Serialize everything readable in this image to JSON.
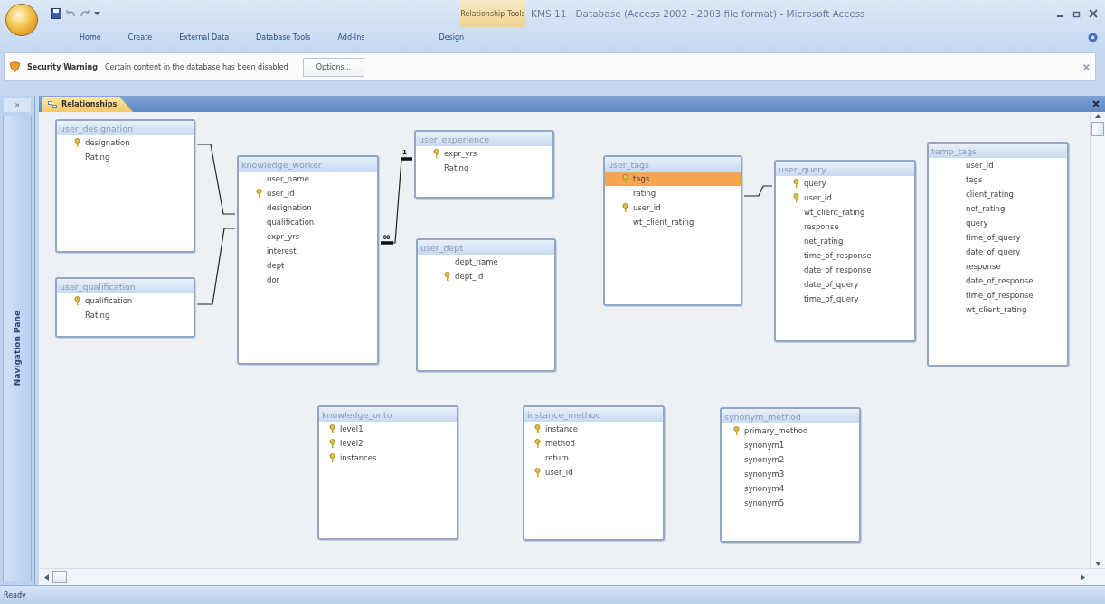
{
  "window": {
    "title": "KMS 11 : Database (Access 2002 - 2003 file format) - Microsoft Access"
  },
  "ribbon": {
    "tabs": [
      {
        "label": "Home",
        "selected": false
      },
      {
        "label": "Create",
        "selected": false
      },
      {
        "label": "External Data",
        "selected": false
      },
      {
        "label": "Database Tools",
        "selected": false
      },
      {
        "label": "Add-Ins",
        "selected": false
      }
    ],
    "contextual_group": {
      "label": "Relationship Tools",
      "tabs": [
        {
          "label": "Design",
          "selected": false
        }
      ]
    }
  },
  "security_bar": {
    "label": "Security Warning",
    "message": "Certain content in the database has been disabled",
    "button": "Options..."
  },
  "navigation_pane": {
    "toggle": "»",
    "label": "Navigation Pane"
  },
  "document_tabs": [
    {
      "label": "Relationships",
      "selected": true
    }
  ],
  "tables": [
    {
      "name": "user_designation",
      "fields": [
        {
          "name": "designation",
          "key": true,
          "selected": false
        },
        {
          "name": "Rating",
          "key": false,
          "selected": false
        }
      ]
    },
    {
      "name": "user_qualification",
      "fields": [
        {
          "name": "qualification",
          "key": true,
          "selected": false
        },
        {
          "name": "Rating",
          "key": false,
          "selected": false
        }
      ]
    },
    {
      "name": "knowledge_worker",
      "fields": [
        {
          "name": "user_name",
          "key": false,
          "selected": false
        },
        {
          "name": "user_id",
          "key": true,
          "selected": false
        },
        {
          "name": "designation",
          "key": false,
          "selected": false
        },
        {
          "name": "qualification",
          "key": false,
          "selected": false
        },
        {
          "name": "expr_yrs",
          "key": false,
          "selected": false
        },
        {
          "name": "interest",
          "key": false,
          "selected": false
        },
        {
          "name": "dept",
          "key": false,
          "selected": false
        },
        {
          "name": "dor",
          "key": false,
          "selected": false
        }
      ]
    },
    {
      "name": "user_experience",
      "fields": [
        {
          "name": "expr_yrs",
          "key": true,
          "selected": false
        },
        {
          "name": "Rating",
          "key": false,
          "selected": false
        }
      ]
    },
    {
      "name": "user_dept",
      "fields": [
        {
          "name": "dept_name",
          "key": false,
          "selected": false
        },
        {
          "name": "dept_id",
          "key": true,
          "selected": false
        }
      ]
    },
    {
      "name": "user_tags",
      "fields": [
        {
          "name": "tags",
          "key": true,
          "selected": true
        },
        {
          "name": "rating",
          "key": false,
          "selected": false
        },
        {
          "name": "user_id",
          "key": true,
          "selected": false
        },
        {
          "name": "wt_client_rating",
          "key": false,
          "selected": false
        }
      ]
    },
    {
      "name": "user_query",
      "fields": [
        {
          "name": "query",
          "key": true,
          "selected": false
        },
        {
          "name": "user_id",
          "key": true,
          "selected": false
        },
        {
          "name": "wt_client_rating",
          "key": false,
          "selected": false
        },
        {
          "name": "response",
          "key": false,
          "selected": false
        },
        {
          "name": "net_rating",
          "key": false,
          "selected": false
        },
        {
          "name": "time_of_response",
          "key": false,
          "selected": false
        },
        {
          "name": "date_of_response",
          "key": false,
          "selected": false
        },
        {
          "name": "date_of_query",
          "key": false,
          "selected": false
        },
        {
          "name": "time_of_query",
          "key": false,
          "selected": false
        }
      ]
    },
    {
      "name": "temp_tags",
      "fields": [
        {
          "name": "user_id",
          "key": false,
          "selected": false
        },
        {
          "name": "tags",
          "key": false,
          "selected": false
        },
        {
          "name": "client_rating",
          "key": false,
          "selected": false
        },
        {
          "name": "net_rating",
          "key": false,
          "selected": false
        },
        {
          "name": "query",
          "key": false,
          "selected": false
        },
        {
          "name": "time_of_query",
          "key": false,
          "selected": false
        },
        {
          "name": "date_of_query",
          "key": false,
          "selected": false
        },
        {
          "name": "response",
          "key": false,
          "selected": false
        },
        {
          "name": "date_of_response",
          "key": false,
          "selected": false
        },
        {
          "name": "time_of_response",
          "key": false,
          "selected": false
        },
        {
          "name": "wt_client_rating",
          "key": false,
          "selected": false
        }
      ]
    },
    {
      "name": "knowledge_onto",
      "fields": [
        {
          "name": "level1",
          "key": true,
          "selected": false
        },
        {
          "name": "level2",
          "key": true,
          "selected": false
        },
        {
          "name": "instances",
          "key": true,
          "selected": false
        }
      ]
    },
    {
      "name": "instance_method",
      "fields": [
        {
          "name": "instance",
          "key": true,
          "selected": false
        },
        {
          "name": "method",
          "key": true,
          "selected": false
        },
        {
          "name": "return",
          "key": false,
          "selected": false
        },
        {
          "name": "user_id",
          "key": true,
          "selected": false
        }
      ]
    },
    {
      "name": "synonym_method",
      "fields": [
        {
          "name": "primary_method",
          "key": true,
          "selected": false
        },
        {
          "name": "synonym1",
          "key": false,
          "selected": false
        },
        {
          "name": "synonym2",
          "key": false,
          "selected": false
        },
        {
          "name": "synonym3",
          "key": false,
          "selected": false
        },
        {
          "name": "synonym4",
          "key": false,
          "selected": false
        },
        {
          "name": "synonym5",
          "key": false,
          "selected": false
        }
      ]
    }
  ],
  "relationships": [
    {
      "kind": "plain"
    },
    {
      "kind": "plain"
    },
    {
      "kind": "one-to-many",
      "one_label": "1",
      "many_label": "∞"
    },
    {
      "kind": "plain"
    }
  ],
  "status_bar": {
    "text": "Ready"
  }
}
